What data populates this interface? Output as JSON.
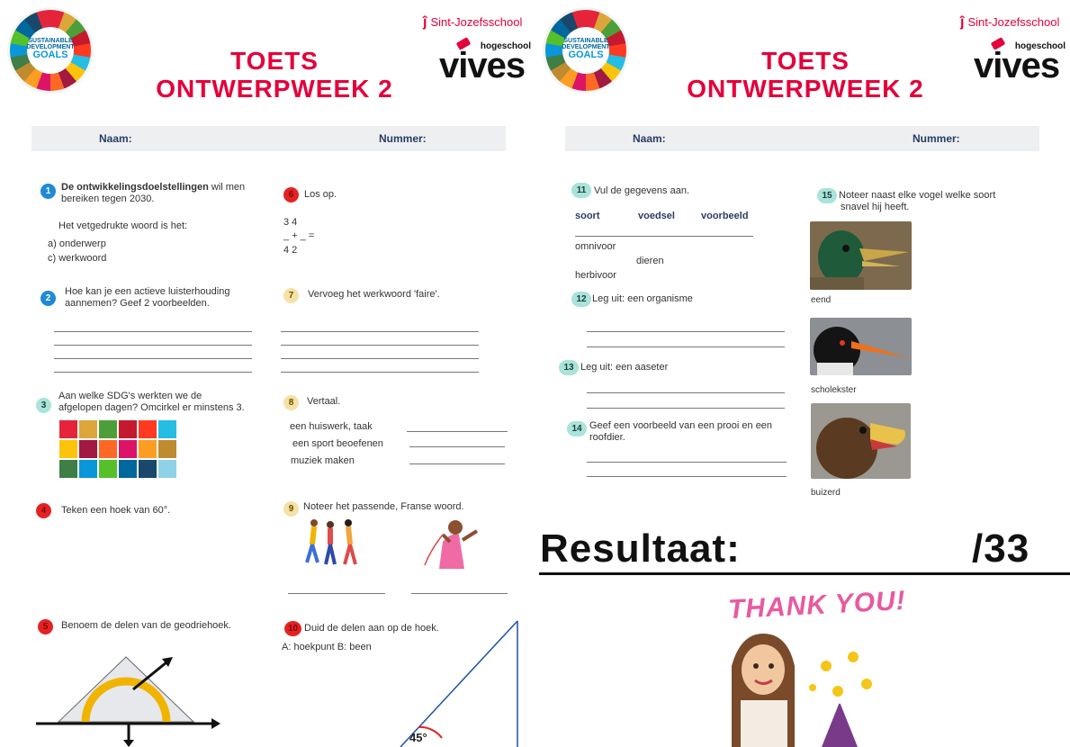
{
  "header": {
    "school": "Sint-Jozefsschool",
    "school_mark": "ĵ",
    "hogeschool": "hogeschool",
    "vives": "vives",
    "title_line1": "TOETS",
    "title_line2": "ONTWERPWEEK 2",
    "sdg_line1": "SUSTAINABLE",
    "sdg_line2": "DEVELOPMENT",
    "sdg_line3": "GOALS"
  },
  "namebar": {
    "naam": "Naam:",
    "nummer": "Nummer:"
  },
  "colors": {
    "accent_red": "#e4003a",
    "navy": "#2a3c66",
    "sdg_blue": "#1f8ad6"
  },
  "page1": {
    "q1": {
      "n": "1",
      "bold": "De ontwikkelingsdoelstellingen",
      "rest": " wil men",
      "line2": "bereiken tegen 2030.",
      "prompt": "Het vetgedrukte woord is het:",
      "opt_a": "a) onderwerp",
      "opt_c": "c) werkwoord"
    },
    "q2": {
      "n": "2",
      "line1": "Hoe kan je een actieve luisterhouding",
      "line2": "aannemen? Geef 2 voorbeelden."
    },
    "q3": {
      "n": "3",
      "line1": "Aan welke SDG's werkten we de",
      "line2": "afgelopen dagen? Omcirkel er minstens 3."
    },
    "q4": {
      "n": "4",
      "text": "Teken een hoek van 60°."
    },
    "q5": {
      "n": "5",
      "text": "Benoem de delen van de geodriehoek."
    },
    "q6": {
      "n": "6",
      "text": "Los op.",
      "top": "3    4",
      "mid": "_  +  _  =",
      "bot": "4    2"
    },
    "q7": {
      "n": "7",
      "text": "Vervoeg het werkwoord 'faire'."
    },
    "q8": {
      "n": "8",
      "text": "Vertaal.",
      "items": [
        "een huiswerk, taak",
        "een sport beoefenen",
        "muziek maken"
      ]
    },
    "q9": {
      "n": "9",
      "text": "Noteer het passende, Franse woord."
    },
    "q10": {
      "n": "10",
      "text": "Duid de delen aan op de hoek.",
      "sub": "A: hoekpunt   B: been",
      "angle": "45°"
    }
  },
  "page2": {
    "q11": {
      "n": "11",
      "text": "Vul de gegevens aan.",
      "headers": [
        "soort",
        "voedsel",
        "voorbeeld"
      ],
      "omnivoor": "omnivoor",
      "dieren": "dieren",
      "herbivoor": "herbivoor"
    },
    "q12": {
      "n": "12",
      "text": "Leg uit: een organisme"
    },
    "q13": {
      "n": "13",
      "text": "Leg uit: een aaseter"
    },
    "q14": {
      "n": "14",
      "line1": "Geef een voorbeeld van een prooi en een",
      "line2": "roofdier."
    },
    "q15": {
      "n": "15",
      "line1": "Noteer naast elke vogel welke soort",
      "line2": "snavel hij heeft."
    },
    "birds": [
      "eend",
      "scholekster",
      "buizerd"
    ],
    "result_label": "Resultaat:",
    "result_max": "/33",
    "thanks": "THANK YOU!"
  }
}
